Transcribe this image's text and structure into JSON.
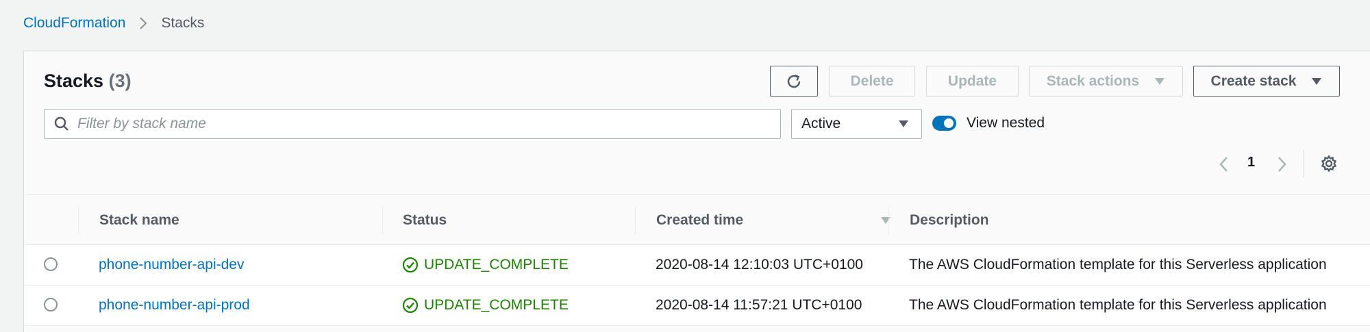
{
  "breadcrumb": {
    "root": "CloudFormation",
    "current": "Stacks"
  },
  "panel": {
    "title": "Stacks",
    "count": "(3)"
  },
  "toolbar": {
    "delete_label": "Delete",
    "update_label": "Update",
    "stack_actions_label": "Stack actions",
    "create_stack_label": "Create stack"
  },
  "filter": {
    "placeholder": "Filter by stack name",
    "status_select": "Active",
    "view_nested_label": "View nested",
    "view_nested_on": true
  },
  "pagination": {
    "current_page": "1"
  },
  "table": {
    "columns": [
      "Stack name",
      "Status",
      "Created time",
      "Description"
    ],
    "rows": [
      {
        "name": "phone-number-api-dev",
        "status": "UPDATE_COMPLETE",
        "created": "2020-08-14 12:10:03 UTC+0100",
        "description": "The AWS CloudFormation template for this Serverless application"
      },
      {
        "name": "phone-number-api-prod",
        "status": "UPDATE_COMPLETE",
        "created": "2020-08-14 11:57:21 UTC+0100",
        "description": "The AWS CloudFormation template for this Serverless application"
      }
    ]
  },
  "colors": {
    "link": "#0073bb",
    "success": "#1d8102",
    "toggle_on": "#0073bb"
  }
}
